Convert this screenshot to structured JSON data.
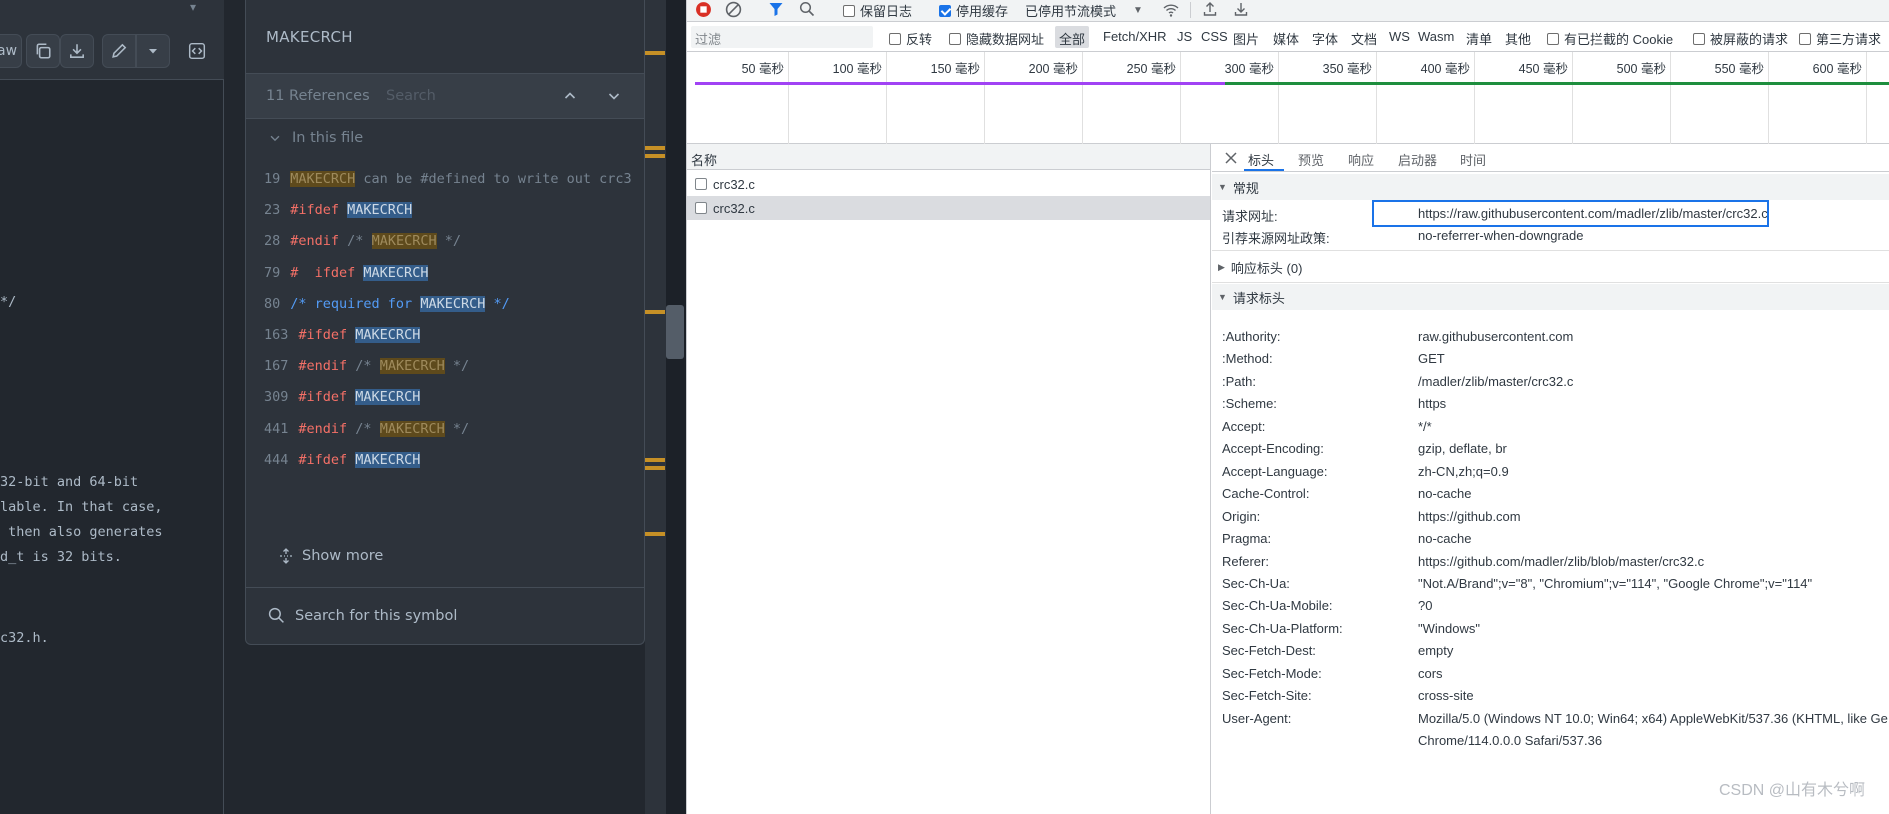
{
  "github": {
    "toolbar": {
      "raw_label": "aw"
    },
    "code_lines": [
      "*/",
      "32-bit and 64-bit",
      "lable. In that case,",
      " then also generates",
      "d_t is 32 bits.",
      "c32.h."
    ],
    "ref_panel": {
      "symbol": "MAKECRCH",
      "count_label": "11 References",
      "search_placeholder": "Search",
      "file_group": "In this file",
      "refs": [
        {
          "line": "19",
          "pre": "",
          "pre2": "",
          "sym": "MAKECRCH",
          "post": " can be #defined to write out crc3"
        },
        {
          "line": "23",
          "pre": "#ifdef ",
          "pre2": "",
          "sym": "MAKECRCH",
          "post": ""
        },
        {
          "line": "28",
          "pre": "#endif",
          "pre2": " /* ",
          "sym": "MAKECRCH",
          "post": " */"
        },
        {
          "line": "79",
          "pre": "#  ifdef ",
          "pre2": "",
          "sym": "MAKECRCH",
          "post": ""
        },
        {
          "line": "80",
          "pre": "/* required for ",
          "pre2": "",
          "sym": "MAKECRCH",
          "post": " */"
        },
        {
          "line": "163",
          "pre": "#ifdef ",
          "pre2": "",
          "sym": "MAKECRCH",
          "post": ""
        },
        {
          "line": "167",
          "pre": "#endif",
          "pre2": " /* ",
          "sym": "MAKECRCH",
          "post": " */"
        },
        {
          "line": "309",
          "pre": "#ifdef ",
          "pre2": "",
          "sym": "MAKECRCH",
          "post": ""
        },
        {
          "line": "441",
          "pre": "#endif",
          "pre2": " /* ",
          "sym": "MAKECRCH",
          "post": " */"
        },
        {
          "line": "444",
          "pre": "#ifdef ",
          "pre2": "",
          "sym": "MAKECRCH",
          "post": ""
        }
      ],
      "show_more": "Show more",
      "search_symbol": "Search for this symbol"
    }
  },
  "devtools": {
    "toolbar1": {
      "preserve_log": "保留日志",
      "disable_cache": "停用缓存",
      "throttle": "已停用节流模式"
    },
    "filter": {
      "placeholder": "过滤",
      "invert": "反转",
      "hide_data_urls": "隐藏数据网址",
      "types": [
        "全部",
        "Fetch/XHR",
        "JS",
        "CSS",
        "图片",
        "媒体",
        "字体",
        "文档",
        "WS",
        "Wasm",
        "清单",
        "其他"
      ],
      "blocked_cookies": "有已拦截的 Cookie",
      "blocked_requests": "被屏蔽的请求",
      "third_party": "第三方请求"
    },
    "timeline_labels": [
      "50 毫秒",
      "100 毫秒",
      "150 毫秒",
      "200 毫秒",
      "250 毫秒",
      "300 毫秒",
      "350 毫秒",
      "400 毫秒",
      "450 毫秒",
      "500 毫秒",
      "550 毫秒",
      "600 毫秒"
    ],
    "list": {
      "header": "名称",
      "rows": [
        "crc32.c",
        "crc32.c"
      ]
    },
    "detail_tabs": [
      "标头",
      "预览",
      "响应",
      "启动器",
      "时间"
    ],
    "general": {
      "title": "常规",
      "request_url_label": "请求网址:",
      "request_url": "https://raw.githubusercontent.com/madler/zlib/master/crc32.c",
      "referrer_policy_label": "引荐来源网址政策:",
      "referrer_policy": "no-referrer-when-downgrade"
    },
    "response_headers_title": "响应标头 (0)",
    "request_headers_title": "请求标头",
    "request_headers": [
      {
        "k": ":Authority:",
        "v": "raw.githubusercontent.com"
      },
      {
        "k": ":Method:",
        "v": "GET"
      },
      {
        "k": ":Path:",
        "v": "/madler/zlib/master/crc32.c"
      },
      {
        "k": ":Scheme:",
        "v": "https"
      },
      {
        "k": "Accept:",
        "v": "*/*"
      },
      {
        "k": "Accept-Encoding:",
        "v": "gzip, deflate, br"
      },
      {
        "k": "Accept-Language:",
        "v": "zh-CN,zh;q=0.9"
      },
      {
        "k": "Cache-Control:",
        "v": "no-cache"
      },
      {
        "k": "Origin:",
        "v": "https://github.com"
      },
      {
        "k": "Pragma:",
        "v": "no-cache"
      },
      {
        "k": "Referer:",
        "v": "https://github.com/madler/zlib/blob/master/crc32.c"
      },
      {
        "k": "Sec-Ch-Ua:",
        "v": "\"Not.A/Brand\";v=\"8\", \"Chromium\";v=\"114\", \"Google Chrome\";v=\"114\""
      },
      {
        "k": "Sec-Ch-Ua-Mobile:",
        "v": "?0"
      },
      {
        "k": "Sec-Ch-Ua-Platform:",
        "v": "\"Windows\""
      },
      {
        "k": "Sec-Fetch-Dest:",
        "v": "empty"
      },
      {
        "k": "Sec-Fetch-Mode:",
        "v": "cors"
      },
      {
        "k": "Sec-Fetch-Site:",
        "v": "cross-site"
      },
      {
        "k": "User-Agent:",
        "v": "Mozilla/5.0 (Windows NT 10.0; Win64; x64) AppleWebKit/537.36 (KHTML, like Ge"
      }
    ],
    "user_agent_cont": "Chrome/114.0.0.0 Safari/537.36",
    "watermark": "CSDN @山有木兮啊"
  },
  "colors": {
    "gh_bg": "#22272e",
    "gh_keyword": "#f47067",
    "gh_symbol_highlight": "#345d8a",
    "devtools_accent": "#1a73e8",
    "timeline_purple": "#a142f4",
    "timeline_green": "#1e8e3e"
  }
}
